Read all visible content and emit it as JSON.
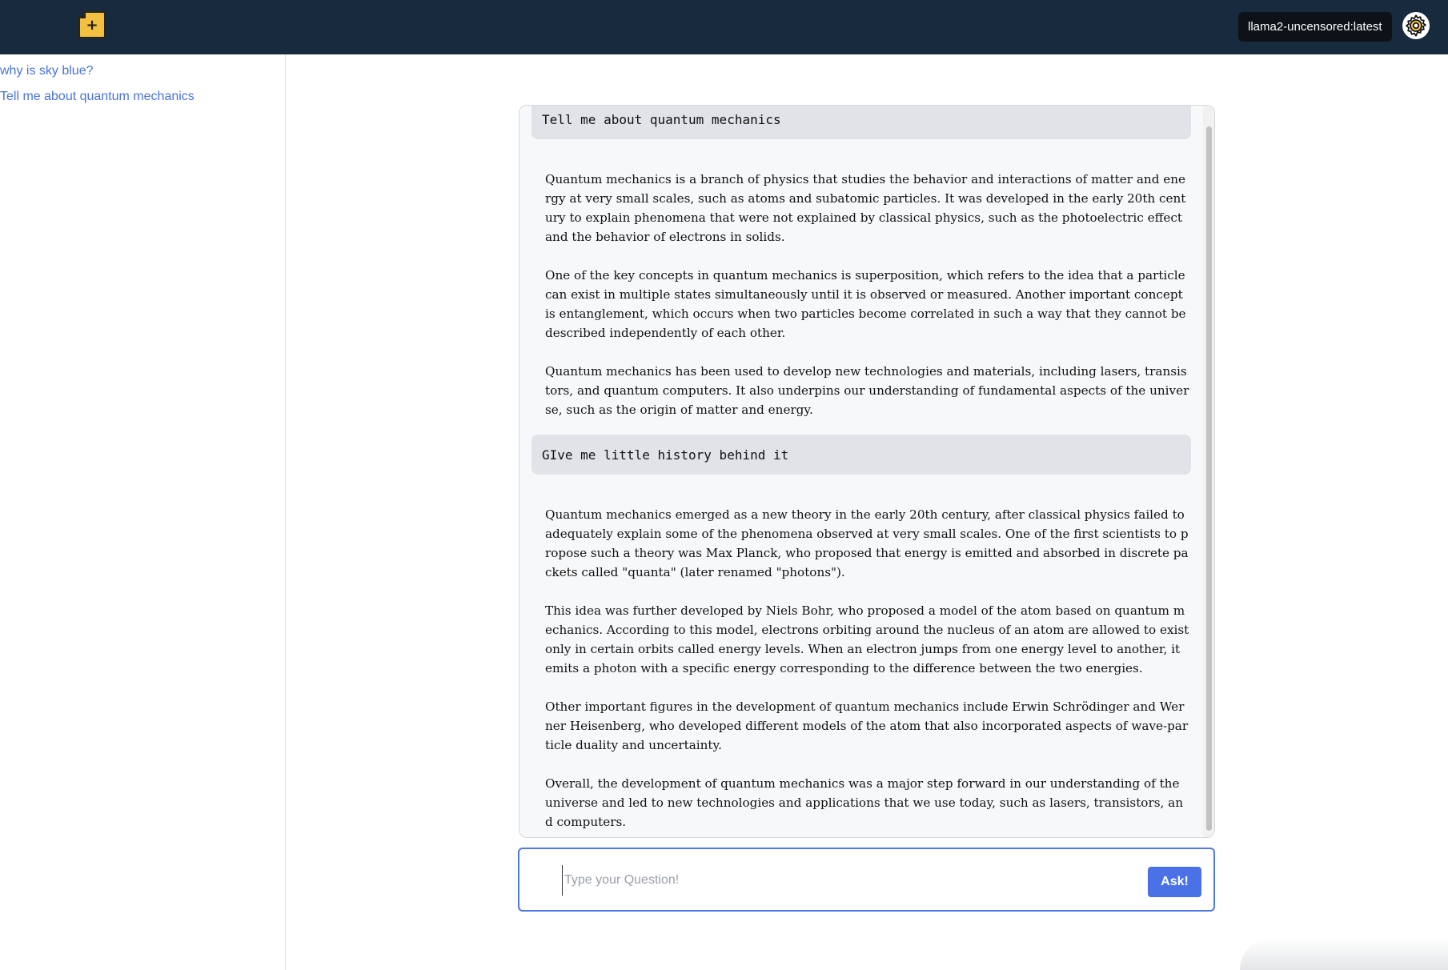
{
  "header": {
    "new_chat_icon": "new-document-icon",
    "model_name": "llama2-uncensored:latest",
    "settings_icon": "gear-icon"
  },
  "sidebar": {
    "items": [
      {
        "label": "why is sky blue?"
      },
      {
        "label": "Tell me about quantum mechanics"
      }
    ]
  },
  "conversation": {
    "messages": [
      {
        "role": "user",
        "text": "Tell me about quantum mechanics"
      },
      {
        "role": "assistant",
        "paragraphs": [
          "Quantum mechanics is a branch of physics that studies the behavior and interactions of matter and energy at very small scales, such as atoms and subatomic particles. It was developed in the early 20th century to explain phenomena that were not explained by classical physics, such as the photoelectric effect and the behavior of electrons in solids.",
          "One of the key concepts in quantum mechanics is superposition, which refers to the idea that a particle can exist in multiple states simultaneously until it is observed or measured. Another important concept is entanglement, which occurs when two particles become correlated in such a way that they cannot be described independently of each other.",
          "Quantum mechanics has been used to develop new technologies and materials, including lasers, transistors, and quantum computers. It also underpins our understanding of fundamental aspects of the universe, such as the origin of matter and energy."
        ]
      },
      {
        "role": "user",
        "text": "GIve me little history behind it"
      },
      {
        "role": "assistant",
        "paragraphs": [
          "Quantum mechanics emerged as a new theory in the early 20th century, after classical physics failed to adequately explain some of the phenomena observed at very small scales. One of the first scientists to propose such a theory was Max Planck, who proposed that energy is emitted and absorbed in discrete packets called \"quanta\" (later renamed \"photons\").",
          "This idea was further developed by Niels Bohr, who proposed a model of the atom based on quantum mechanics. According to this model, electrons orbiting around the nucleus of an atom are allowed to exist only in certain orbits called energy levels. When an electron jumps from one energy level to another, it emits a photon with a specific energy corresponding to the difference between the two energies.",
          "Other important figures in the development of quantum mechanics include Erwin Schrödinger and Werner Heisenberg, who developed different models of the atom that also incorporated aspects of wave-particle duality and uncertainty.",
          "Overall, the development of quantum mechanics was a major step forward in our understanding of the universe and led to new technologies and applications that we use today, such as lasers, transistors, and computers."
        ]
      }
    ]
  },
  "input": {
    "value": "",
    "placeholder": "Type your Question!",
    "submit_label": "Ask!"
  },
  "colors": {
    "header_bg": "#182a3d",
    "accent": "#4a72e6",
    "link": "#4a73d9",
    "icon_yellow": "#f3c141"
  }
}
